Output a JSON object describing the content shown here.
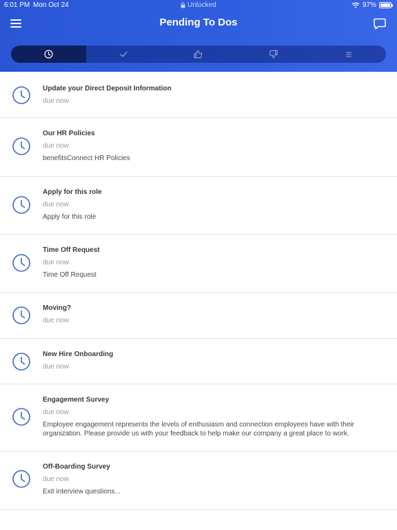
{
  "status_bar": {
    "time": "6:01 PM",
    "date": "Mon Oct 24",
    "lock_text": "Unlocked",
    "battery": "97%",
    "battery_level": 0.97
  },
  "header": {
    "title": "Pending To Dos"
  },
  "tabs": [
    {
      "icon": "clock-icon",
      "active": true
    },
    {
      "icon": "checkmark-icon",
      "active": false
    },
    {
      "icon": "thumbs-up-icon",
      "active": false
    },
    {
      "icon": "thumbs-down-icon",
      "active": false
    },
    {
      "icon": "list-icon",
      "active": false
    }
  ],
  "todos": [
    {
      "title": "Update your Direct Deposit Information",
      "due": "due now",
      "desc": ""
    },
    {
      "title": "Our HR Policies",
      "due": "due now",
      "desc": "benefitsConnect HR Policies"
    },
    {
      "title": "Apply for this role",
      "due": "due now",
      "desc": "Apply for this role"
    },
    {
      "title": "Time Off Request",
      "due": "due now",
      "desc": "Time Off Request"
    },
    {
      "title": "Moving?",
      "due": "due now",
      "desc": ""
    },
    {
      "title": "New Hire Onboarding",
      "due": "due now",
      "desc": ""
    },
    {
      "title": "Engagement Survey",
      "due": "due now",
      "desc": "Employee engagement represents the levels of enthusiasm and connection employees have with their organization. Please provide us with your feedback to help make our company a great place to work."
    },
    {
      "title": "Off-Boarding Survey",
      "due": "due now",
      "desc": "Exit interview questions..."
    }
  ],
  "colors": {
    "header_blue": "#2f5fe0",
    "active_tab": "#0d1f5c",
    "clock_icon": "#3d68c4",
    "due_text": "#8e9aab"
  }
}
